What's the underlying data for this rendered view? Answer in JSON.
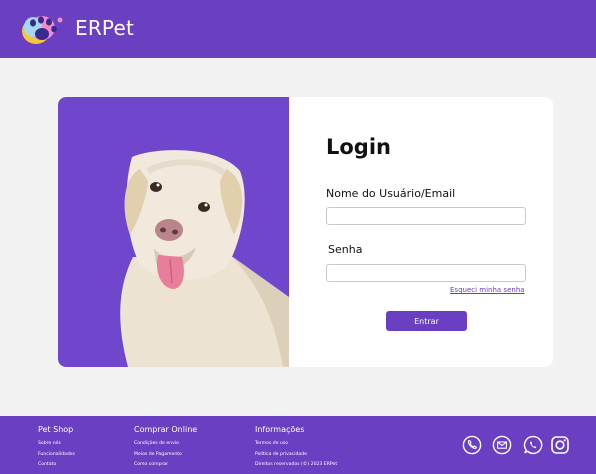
{
  "header": {
    "brand": "ERPet",
    "logo_icon": "paw-logo-icon"
  },
  "login": {
    "title": "Login",
    "username_label": "Nome do Usuário/Email",
    "username_value": "",
    "password_label": "Senha",
    "password_value": "",
    "forgot_link": "Esqueci minha senha",
    "submit_label": "Entrar",
    "image": "labrador-dog-photo"
  },
  "footer": {
    "columns": [
      {
        "title": "Pet Shop",
        "links": [
          "Sobre nós",
          "Funcionalidades",
          "Contato"
        ]
      },
      {
        "title": "Comprar Online",
        "links": [
          "Condições de envio",
          "Meios de Pagamento",
          "Como comprar"
        ]
      },
      {
        "title": "Informações",
        "links": [
          "Termos de uso",
          "Política de privacidade",
          "Direitos reservados (©) 2023 ERPet"
        ]
      }
    ],
    "social_icons": [
      "phone-icon",
      "email-icon",
      "whatsapp-icon",
      "instagram-icon"
    ]
  },
  "colors": {
    "primary": "#6a3fc2",
    "photo_bg": "#7046cc",
    "page_bg": "#f2f2f3"
  }
}
